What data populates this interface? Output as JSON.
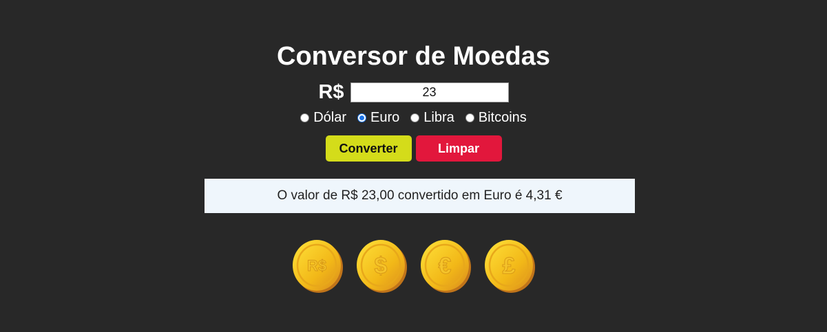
{
  "header": {
    "title": "Conversor de Moedas"
  },
  "form": {
    "currency_symbol": "R$",
    "amount_value": "23",
    "options": [
      {
        "label": "Dólar",
        "checked": false
      },
      {
        "label": "Euro",
        "checked": true
      },
      {
        "label": "Libra",
        "checked": false
      },
      {
        "label": "Bitcoins",
        "checked": false
      }
    ],
    "convert_label": "Converter",
    "clear_label": "Limpar"
  },
  "result": {
    "text": "O valor de R$ 23,00 convertido em Euro é 4,31 €"
  },
  "coins": [
    {
      "icon": "real-coin-icon",
      "glyph": "R$"
    },
    {
      "icon": "dollar-coin-icon",
      "glyph": "$"
    },
    {
      "icon": "euro-coin-icon",
      "glyph": "€"
    },
    {
      "icon": "pound-coin-icon",
      "glyph": "£"
    }
  ],
  "colors": {
    "background": "#282828",
    "convert_button": "#d4dc1a",
    "clear_button": "#e2173c",
    "result_background": "#eff6fc",
    "radio_selected": "#1a73e8"
  }
}
